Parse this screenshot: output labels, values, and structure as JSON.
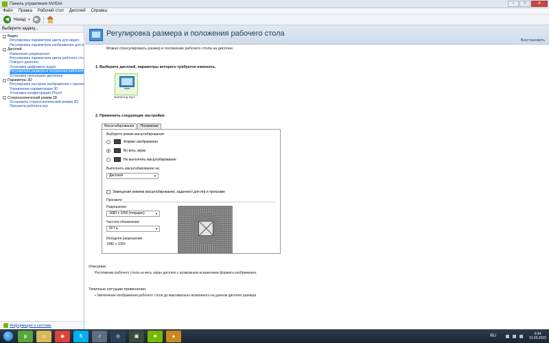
{
  "window": {
    "title": "Панель управления NVIDIA",
    "btn_min": "–",
    "btn_max": "□",
    "btn_close": "✕"
  },
  "menu": [
    "Файл",
    "Правка",
    "Рабочий стол",
    "Дисплей",
    "Справка"
  ],
  "toolbar": {
    "back_label": "Назад",
    "back_arrow": "◀",
    "fwd_arrow": "▶",
    "dropdown": "▾"
  },
  "sidebar": {
    "header": "Выберите задачу...",
    "tree": [
      {
        "type": "cat",
        "label": "Видео",
        "toggle": "–"
      },
      {
        "type": "item",
        "label": "Регулировка параметров цвета для видео"
      },
      {
        "type": "item",
        "label": "Регулировка параметров изображения для видео"
      },
      {
        "type": "cat",
        "label": "Дисплей",
        "toggle": "–"
      },
      {
        "type": "item",
        "label": "Изменение разрешения"
      },
      {
        "type": "item",
        "label": "Регулировка параметров цвета рабочего стола"
      },
      {
        "type": "item",
        "label": "Поворот дисплея"
      },
      {
        "type": "item",
        "label": "Установка цифрового аудио"
      },
      {
        "type": "item",
        "label": "Регулировка размера и положения рабочего стола",
        "selected": true
      },
      {
        "type": "item",
        "label": "Установка нескольких дисплеев"
      },
      {
        "type": "cat",
        "label": "Параметры 3D",
        "toggle": "–"
      },
      {
        "type": "item",
        "label": "Регулировка настроек изображения с просмотром"
      },
      {
        "type": "item",
        "label": "Управление параметрами 3D"
      },
      {
        "type": "item",
        "label": "Установка конфигурации PhysX"
      },
      {
        "type": "cat",
        "label": "Стереоскопический режим 3D",
        "toggle": "–"
      },
      {
        "type": "item",
        "label": "Установить стереоскопический режим 3D"
      },
      {
        "type": "item",
        "label": "Просмотр рейтинга игр"
      }
    ],
    "footer_link": "Информация о системе"
  },
  "page": {
    "title": "Регулировка размера и положения рабочего стола",
    "restore": "Восстановить",
    "subtitle": "Можно отрегулировать размер и положение рабочего стола на дисплее.",
    "section1": "1. Выберите дисплей, параметры которого требуется изменить.",
    "display_name": "Samsung Syn...",
    "section2": "2. Применить следующие настройки:",
    "tabs": [
      "Масштабирование",
      "Положение"
    ],
    "scaling": {
      "mode_label": "Выберите режим масштабирования:",
      "modes": [
        "Формат изображения",
        "Во весь экран",
        "Не выполнять масштабирование"
      ],
      "perform_label": "Выполнить масштабирование на:",
      "perform_value": "Дисплей",
      "override_label": "Замещение режима масштабирования, заданного для игр и программ",
      "preview_label": "Просмотр",
      "resolution_label": "Разрешение:",
      "resolution_value": "1680 x 1050 (текущее)",
      "refresh_label": "Частота обновления:",
      "refresh_value": "60 Гц",
      "source_label": "Исходное разрешение:",
      "source_value": "1680 x 1050"
    },
    "desc_title": "Описание.",
    "desc_text": "Растяжение рабочего стола на весь экран дисплея с возможным искажением формата изображения.",
    "typical_title": "Типичные ситуации применения.",
    "typical_text": "• Увеличение изображения рабочего стола до максимально возможного на данном дисплее размера"
  },
  "taskbar": {
    "apps": [
      {
        "name": "utorrent",
        "glyph": "μ",
        "color": "#57a639"
      },
      {
        "name": "explorer",
        "glyph": "▭",
        "color": "#d9b85a"
      },
      {
        "name": "chrome",
        "glyph": "◉",
        "color": "#db4437"
      },
      {
        "name": "skype",
        "glyph": "S",
        "color": "#00aff0"
      },
      {
        "name": "headphones",
        "glyph": "♫",
        "color": "#5d6d80"
      },
      {
        "name": "steam",
        "glyph": "◎",
        "color": "#2a3f5a"
      },
      {
        "name": "game",
        "glyph": "▣",
        "color": "#3c4c3c"
      },
      {
        "name": "nvidia",
        "glyph": "■",
        "color": "#76b900"
      },
      {
        "name": "game2",
        "glyph": "▲",
        "color": "#c88a1e"
      }
    ],
    "lang": "RU",
    "time": "0:34",
    "date": "31.05.2015"
  }
}
